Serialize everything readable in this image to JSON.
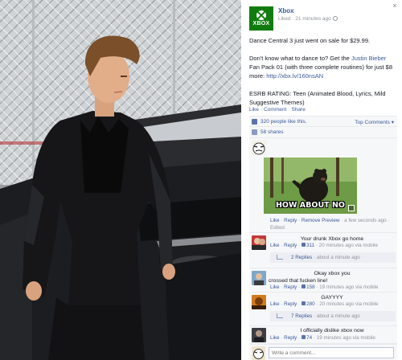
{
  "page": {
    "name": "Xbox",
    "logo_text": "XBOX",
    "meta": "Liked · 21 minutes ago",
    "close_label": "×"
  },
  "post": {
    "line1": "Dance Central 3 just went on sale for $29.99.",
    "line2_pre": "Don't know what to dance to? Get the ",
    "line2_link": "Justin Bieber",
    "line2_post": " Fan Pack 01 (with three complete routines) for just $8 more: ",
    "line2_url": "http://xbx.lv/160nsAN",
    "line3": "ESRB RATING: Teen (Animated Blood, Lyrics, Mild Suggestive Themes)"
  },
  "actions": {
    "like": "Like",
    "comment": "Comment",
    "share": "Share"
  },
  "stats": {
    "likes": "320 people like this.",
    "top_comments": "Top Comments ▾",
    "shares": "58 shares"
  },
  "comments": [
    {
      "text": "",
      "meme_caption": "HOW ABOUT NO",
      "like": "Like",
      "reply": "Reply",
      "remove_preview": "Remove Preview",
      "time": "a few seconds ago",
      "edited": "Edited"
    },
    {
      "text": "Your drunk Xbox go home",
      "like": "Like",
      "reply": "Reply",
      "likes": "311",
      "time": "20 minutes ago via mobile",
      "replies": "2 Replies",
      "replies_time": "about a minute ago"
    },
    {
      "text_line1": "Okay xbox you",
      "text_line2": "crossed that fucken line!",
      "like": "Like",
      "reply": "Reply",
      "likes": "158",
      "time": "19 minutes ago via mobile"
    },
    {
      "text": "GAYYYY",
      "like": "Like",
      "reply": "Reply",
      "likes": "280",
      "time": "20 minutes ago via mobile",
      "replies": "7 Replies",
      "replies_time": "about a minute ago"
    },
    {
      "text": "I officially dislike xbox now",
      "like": "Like",
      "reply": "Reply",
      "likes": "74",
      "time": "19 minutes ago via mobile"
    }
  ],
  "write_comment": {
    "placeholder": "Write a comment..."
  },
  "colors": {
    "link": "#3b5998",
    "xbox_green": "#107c10",
    "muted": "#90949c"
  }
}
